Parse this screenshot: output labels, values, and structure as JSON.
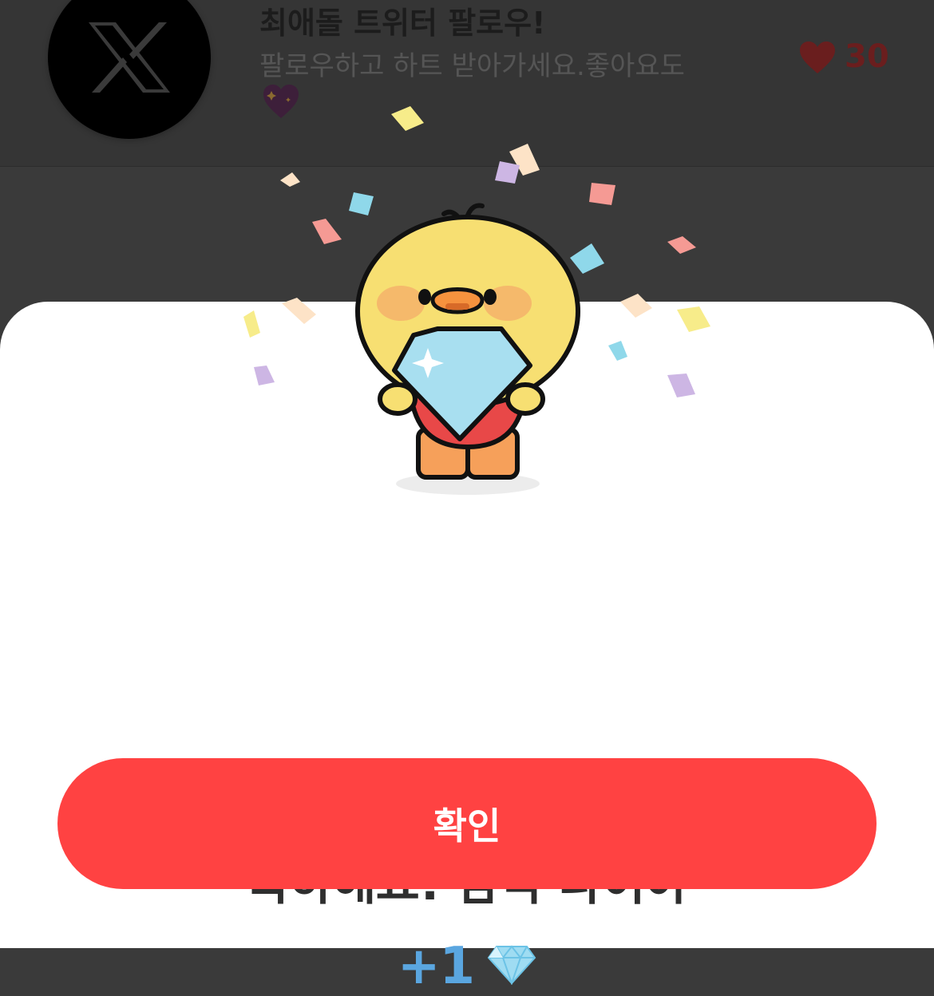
{
  "background_item": {
    "logo_icon": "x-logo-icon",
    "title": "최애돌 트위터 팔로우!",
    "description": "팔로우하고 하트 받아가세요.좋아요도",
    "description_emoji_icon": "sparkling-purple-heart-icon",
    "heart_icon": "heart-icon",
    "heart_count": "30"
  },
  "modal": {
    "mascot_icon": "chick-holding-diamond-icon",
    "title": "축하해요! 깜짝 다이아",
    "reward_amount": "+1",
    "reward_icon": "diamond-icon",
    "confirm_label": "확인"
  },
  "colors": {
    "confirm_button": "#ff4242",
    "reward_text": "#5aa6e0",
    "title_text": "#2e2e2e",
    "overlay": "#3a3a3a"
  }
}
